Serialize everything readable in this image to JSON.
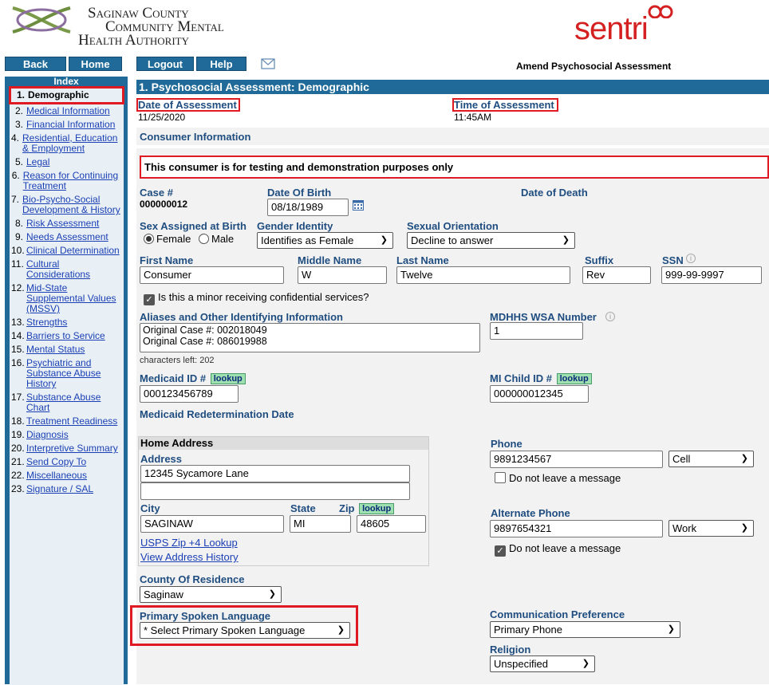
{
  "header": {
    "org_line1": "Saginaw County",
    "org_line2": "Community Mental",
    "org_line3": "Health Authority",
    "brand": "sentri",
    "page_subtitle": "Amend Psychosocial Assessment"
  },
  "nav": {
    "back": "Back",
    "home": "Home",
    "logout": "Logout",
    "help": "Help"
  },
  "sidebar": {
    "title": "Index",
    "items": [
      {
        "n": "1.",
        "label": "Demographic"
      },
      {
        "n": "2.",
        "label": "Medical Information"
      },
      {
        "n": "3.",
        "label": "Financial Information"
      },
      {
        "n": "4.",
        "label": "Residential, Education & Employment"
      },
      {
        "n": "5.",
        "label": "Legal"
      },
      {
        "n": "6.",
        "label": "Reason for Continuing Treatment"
      },
      {
        "n": "7.",
        "label": "Bio-Psycho-Social Development & History"
      },
      {
        "n": "8.",
        "label": "Risk Assessment"
      },
      {
        "n": "9.",
        "label": "Needs Assessment"
      },
      {
        "n": "10.",
        "label": "Clinical Determination"
      },
      {
        "n": "11.",
        "label": "Cultural Considerations"
      },
      {
        "n": "12.",
        "label": "Mid-State Supplemental Values (MSSV)"
      },
      {
        "n": "13.",
        "label": "Strengths"
      },
      {
        "n": "14.",
        "label": "Barriers to Service"
      },
      {
        "n": "15.",
        "label": "Mental Status"
      },
      {
        "n": "16.",
        "label": "Psychiatric and Substance Abuse History"
      },
      {
        "n": "17.",
        "label": "Substance Abuse Chart"
      },
      {
        "n": "18.",
        "label": "Treatment Readiness"
      },
      {
        "n": "19.",
        "label": "Diagnosis"
      },
      {
        "n": "20.",
        "label": "Interpretive Summary"
      },
      {
        "n": "21.",
        "label": "Send Copy To"
      },
      {
        "n": "22.",
        "label": "Miscellaneous"
      },
      {
        "n": "23.",
        "label": "Signature / SAL"
      }
    ]
  },
  "section": {
    "title": "1. Psychosocial Assessment: Demographic"
  },
  "assessment": {
    "date_label": "Date of Assessment",
    "date_value": "11/25/2020",
    "time_label": "Time of Assessment",
    "time_value": "11:45AM"
  },
  "consumer": {
    "header": "Consumer Information",
    "notice": "This consumer is for testing and demonstration purposes only",
    "case_label": "Case #",
    "case_value": "000000012",
    "dob_label": "Date Of Birth",
    "dob_value": "08/18/1989",
    "dod_label": "Date of Death",
    "sex_label": "Sex Assigned at Birth",
    "sex_female": "Female",
    "sex_male": "Male",
    "gender_label": "Gender Identity",
    "gender_value": "Identifies as Female",
    "orientation_label": "Sexual Orientation",
    "orientation_value": "Decline to answer",
    "first_label": "First Name",
    "first_value": "Consumer",
    "middle_label": "Middle Name",
    "middle_value": "W",
    "last_label": "Last Name",
    "last_value": "Twelve",
    "suffix_label": "Suffix",
    "suffix_value": "Rev",
    "ssn_label": "SSN",
    "ssn_value": "999-99-9997",
    "minor_label": "Is this a minor receiving confidential services?",
    "aliases_label": "Aliases and Other Identifying Information",
    "aliases_line1": "Original Case #: 002018049",
    "aliases_line2": "Original Case #: 086019988",
    "chars_left": "characters left: 202",
    "wsa_label": "MDHHS WSA Number",
    "wsa_value": "1",
    "medicaid_label": "Medicaid ID #",
    "medicaid_value": "000123456789",
    "michild_label": "MI Child ID #",
    "michild_value": "000000012345",
    "lookup": "lookup",
    "redetermination_label": "Medicaid Redetermination Date"
  },
  "address": {
    "header": "Home Address",
    "address_label": "Address",
    "address_line1": "12345 Sycamore Lane",
    "address_line2": "",
    "city_label": "City",
    "city_value": "SAGINAW",
    "state_label": "State",
    "state_value": "MI",
    "zip_label": "Zip",
    "zip_value": "48605",
    "usps_link": "USPS Zip +4 Lookup",
    "history_link": "View Address History",
    "county_label": "County Of Residence",
    "county_value": "Saginaw"
  },
  "phone": {
    "phone_label": "Phone",
    "phone_value": "9891234567",
    "phone_type": "Cell",
    "no_msg_label": "Do not leave a message",
    "alt_label": "Alternate Phone",
    "alt_value": "9897654321",
    "alt_type": "Work",
    "alt_no_msg_label": "Do not leave a message"
  },
  "language": {
    "primary_label": "Primary Spoken Language",
    "primary_value": "* Select Primary Spoken Language",
    "comm_label": "Communication Preference",
    "comm_value": "Primary Phone",
    "religion_label": "Religion",
    "religion_value": "Unspecified"
  }
}
